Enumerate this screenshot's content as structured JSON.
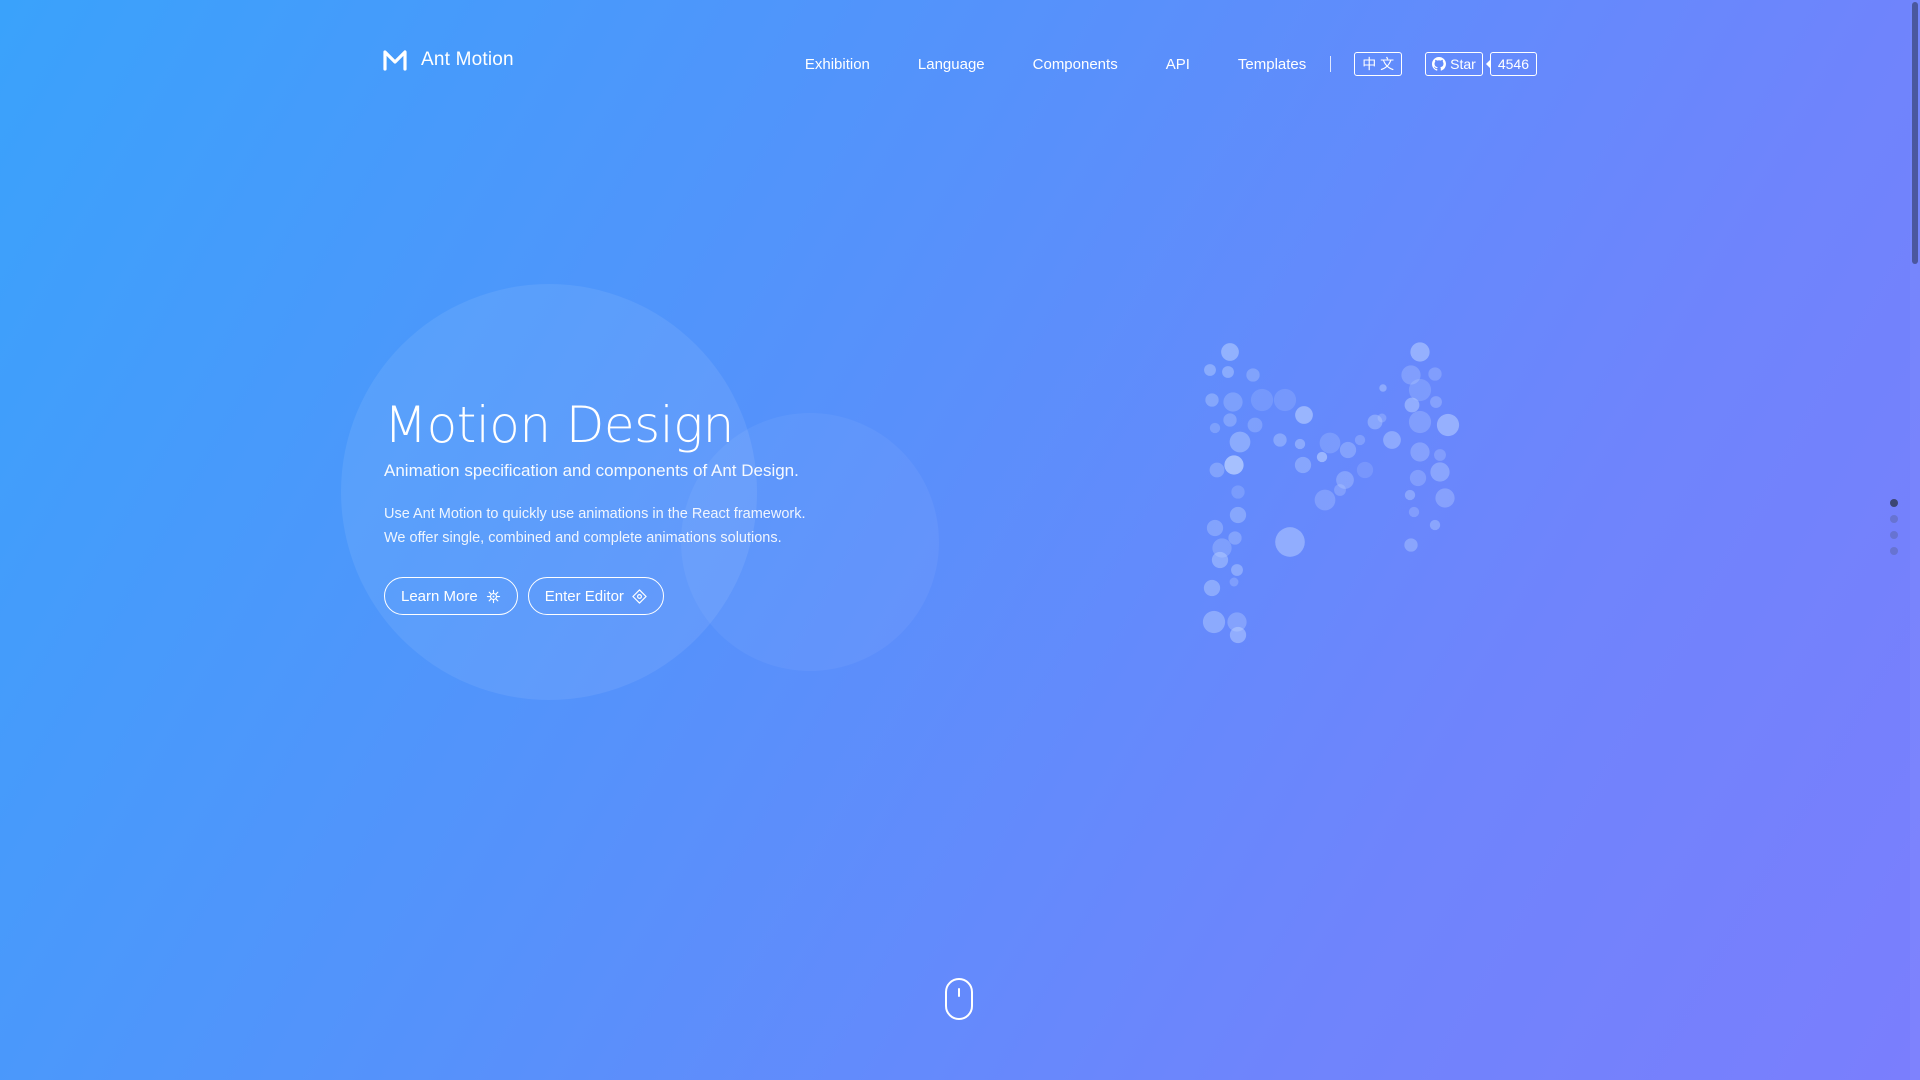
{
  "header": {
    "brand": "Ant Motion",
    "nav": [
      "Exhibition",
      "Language",
      "Components",
      "API",
      "Templates"
    ],
    "language_toggle": "中 文",
    "github": {
      "star_label": "Star",
      "star_count": "4546"
    }
  },
  "hero": {
    "title": "Motion Design",
    "subtitle": "Animation specification and components of Ant Design.",
    "desc_line1": "Use Ant Motion to quickly use animations in the React framework.",
    "desc_line2": "We offer single, combined and complete animations solutions.",
    "learn_more": "Learn More",
    "enter_editor": "Enter Editor"
  },
  "pager": {
    "count": 4,
    "active_index": 0
  },
  "colors": {
    "gradient_start": "#3aa2fb",
    "gradient_end": "#7a7efd",
    "particle": "#bcd2ff"
  },
  "icons": {
    "logo": "ant-motion-logo",
    "github": "github-icon",
    "learn_more": "learn-more-icon",
    "enter_editor": "enter-editor-icon",
    "scroll": "mouse-scroll-icon"
  }
}
